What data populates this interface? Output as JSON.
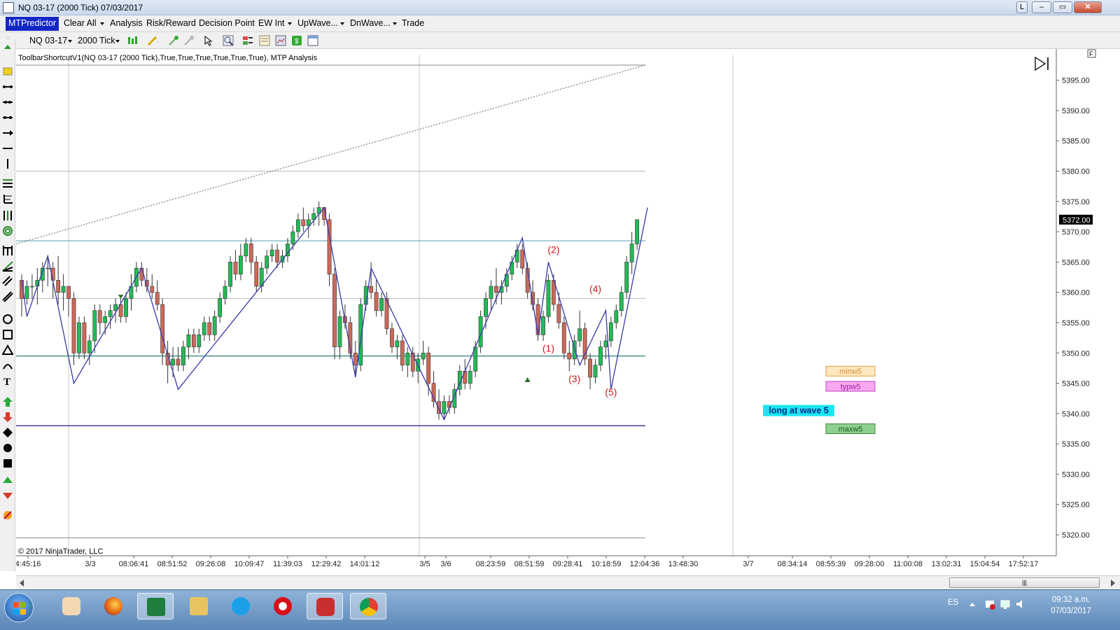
{
  "window": {
    "title": "NQ 03-17 (2000 Tick)  07/03/2017",
    "btn_l": "L",
    "btn_min": "–",
    "btn_max": "▭",
    "btn_close": "✕"
  },
  "menu": {
    "brand": "MTPredictor",
    "items": [
      "Clear All",
      "Analysis",
      "Risk/Reward",
      "Decision Point",
      "EW Int",
      "UpWave...",
      "DnWave...",
      "Trade"
    ]
  },
  "toolbar": {
    "instrument": "NQ 03-17",
    "period": "2000 Tick"
  },
  "chart_header": "ToolbarShortcutV1(NQ 03-17 (2000 Tick),True,True,True,True,True,True), MTP Analysis",
  "copyright": "© 2017 NinjaTrader, LLC",
  "chart_data": {
    "type": "candlestick",
    "instrument": "NQ 03-17",
    "period": "2000 Tick",
    "ylim": [
      5317,
      5399
    ],
    "yticks": [
      "5395.00",
      "5390.00",
      "5385.00",
      "5380.00",
      "5375.00",
      "5370.00",
      "5365.00",
      "5360.00",
      "5355.00",
      "5350.00",
      "5345.00",
      "5340.00",
      "5335.00",
      "5330.00",
      "5325.00",
      "5320.00"
    ],
    "last_price": "5372.00",
    "xtick_labels": [
      "4:45:16",
      "3/3",
      "08:06:41",
      "08:51:52",
      "09:26:08",
      "10:09:47",
      "11:39:03",
      "12:29:42",
      "14:01:12",
      "3/5",
      "3/6",
      "08:23:59",
      "08:51:59",
      "09:28:41",
      "10:18:59",
      "12:04:36",
      "13:48:30",
      "3/7",
      "08:34:14",
      "08:55:39",
      "09:28:00",
      "11:00:08",
      "13:02:31",
      "15:04:54",
      "17:52:17"
    ],
    "candles": [
      [
        5362,
        5363,
        5356,
        5359
      ],
      [
        5359,
        5362,
        5358,
        5361
      ],
      [
        5361,
        5363,
        5359,
        5361
      ],
      [
        5361,
        5364,
        5358,
        5362
      ],
      [
        5362,
        5365,
        5360,
        5364
      ],
      [
        5364,
        5366,
        5361,
        5364
      ],
      [
        5364,
        5365,
        5359,
        5362
      ],
      [
        5362,
        5366,
        5358,
        5360
      ],
      [
        5360,
        5363,
        5357,
        5361
      ],
      [
        5361,
        5361,
        5356,
        5359
      ],
      [
        5359,
        5360,
        5348,
        5350
      ],
      [
        5350,
        5356,
        5349,
        5355
      ],
      [
        5355,
        5356,
        5349,
        5350
      ],
      [
        5350,
        5353,
        5348,
        5352
      ],
      [
        5352,
        5358,
        5350,
        5357
      ],
      [
        5357,
        5358,
        5353,
        5355
      ],
      [
        5355,
        5357,
        5353,
        5356
      ],
      [
        5356,
        5358,
        5354,
        5357
      ],
      [
        5357,
        5359,
        5355,
        5358
      ],
      [
        5358,
        5359,
        5355,
        5356
      ],
      [
        5356,
        5360,
        5355,
        5359
      ],
      [
        5359,
        5363,
        5357,
        5361
      ],
      [
        5361,
        5365,
        5360,
        5364
      ],
      [
        5364,
        5365,
        5361,
        5362
      ],
      [
        5362,
        5364,
        5360,
        5361
      ],
      [
        5361,
        5363,
        5359,
        5360
      ],
      [
        5360,
        5362,
        5357,
        5358
      ],
      [
        5358,
        5359,
        5348,
        5350
      ],
      [
        5350,
        5352,
        5345,
        5348
      ],
      [
        5348,
        5351,
        5346,
        5349
      ],
      [
        5349,
        5351,
        5347,
        5348
      ],
      [
        5348,
        5352,
        5347,
        5351
      ],
      [
        5351,
        5354,
        5349,
        5353
      ],
      [
        5353,
        5354,
        5350,
        5351
      ],
      [
        5351,
        5354,
        5350,
        5353
      ],
      [
        5353,
        5356,
        5352,
        5355
      ],
      [
        5355,
        5356,
        5352,
        5353
      ],
      [
        5353,
        5357,
        5352,
        5356
      ],
      [
        5356,
        5360,
        5355,
        5359
      ],
      [
        5359,
        5362,
        5358,
        5361
      ],
      [
        5361,
        5366,
        5360,
        5365
      ],
      [
        5365,
        5367,
        5362,
        5363
      ],
      [
        5363,
        5368,
        5362,
        5366
      ],
      [
        5366,
        5369,
        5365,
        5368
      ],
      [
        5368,
        5369,
        5363,
        5365
      ],
      [
        5365,
        5366,
        5360,
        5361
      ],
      [
        5361,
        5365,
        5360,
        5364
      ],
      [
        5364,
        5367,
        5363,
        5366
      ],
      [
        5366,
        5368,
        5365,
        5367
      ],
      [
        5367,
        5368,
        5364,
        5365
      ],
      [
        5365,
        5367,
        5364,
        5366
      ],
      [
        5366,
        5369,
        5365,
        5368
      ],
      [
        5368,
        5371,
        5367,
        5370
      ],
      [
        5370,
        5373,
        5369,
        5372
      ],
      [
        5372,
        5374,
        5370,
        5371
      ],
      [
        5371,
        5373,
        5369,
        5372
      ],
      [
        5372,
        5374,
        5371,
        5373
      ],
      [
        5373,
        5375,
        5371,
        5374
      ],
      [
        5374,
        5374,
        5371,
        5372
      ],
      [
        5372,
        5373,
        5361,
        5363
      ],
      [
        5363,
        5364,
        5349,
        5351
      ],
      [
        5351,
        5357,
        5349,
        5356
      ],
      [
        5356,
        5358,
        5354,
        5355
      ],
      [
        5355,
        5356,
        5349,
        5350
      ],
      [
        5350,
        5352,
        5346,
        5348
      ],
      [
        5348,
        5359,
        5347,
        5358
      ],
      [
        5358,
        5362,
        5357,
        5361
      ],
      [
        5361,
        5365,
        5359,
        5360
      ],
      [
        5360,
        5362,
        5356,
        5357
      ],
      [
        5357,
        5360,
        5356,
        5359
      ],
      [
        5359,
        5360,
        5353,
        5354
      ],
      [
        5354,
        5355,
        5350,
        5351
      ],
      [
        5351,
        5353,
        5349,
        5352
      ],
      [
        5352,
        5353,
        5347,
        5348
      ],
      [
        5348,
        5351,
        5346,
        5350
      ],
      [
        5350,
        5351,
        5346,
        5347
      ],
      [
        5347,
        5350,
        5345,
        5349
      ],
      [
        5349,
        5352,
        5348,
        5350
      ],
      [
        5350,
        5351,
        5343,
        5345
      ],
      [
        5345,
        5347,
        5341,
        5342
      ],
      [
        5342,
        5344,
        5339,
        5340
      ],
      [
        5340,
        5343,
        5339,
        5342
      ],
      [
        5342,
        5343,
        5340,
        5341
      ],
      [
        5341,
        5345,
        5340,
        5344
      ],
      [
        5344,
        5348,
        5343,
        5347
      ],
      [
        5347,
        5349,
        5344,
        5345
      ],
      [
        5345,
        5348,
        5344,
        5347
      ],
      [
        5347,
        5352,
        5346,
        5351
      ],
      [
        5351,
        5357,
        5350,
        5356
      ],
      [
        5356,
        5360,
        5354,
        5359
      ],
      [
        5359,
        5362,
        5357,
        5361
      ],
      [
        5361,
        5364,
        5358,
        5360
      ],
      [
        5360,
        5362,
        5358,
        5361
      ],
      [
        5361,
        5364,
        5360,
        5363
      ],
      [
        5363,
        5366,
        5362,
        5365
      ],
      [
        5365,
        5368,
        5364,
        5367
      ],
      [
        5367,
        5368,
        5363,
        5364
      ],
      [
        5364,
        5365,
        5359,
        5360
      ],
      [
        5360,
        5362,
        5357,
        5358
      ],
      [
        5358,
        5359,
        5352,
        5353
      ],
      [
        5353,
        5357,
        5352,
        5356
      ],
      [
        5356,
        5363,
        5355,
        5362
      ],
      [
        5362,
        5363,
        5357,
        5358
      ],
      [
        5358,
        5360,
        5354,
        5355
      ],
      [
        5355,
        5356,
        5349,
        5350
      ],
      [
        5350,
        5352,
        5347,
        5349
      ],
      [
        5349,
        5353,
        5348,
        5352
      ],
      [
        5352,
        5357,
        5351,
        5354
      ],
      [
        5354,
        5355,
        5348,
        5349
      ],
      [
        5349,
        5350,
        5344,
        5346
      ],
      [
        5346,
        5349,
        5345,
        5348
      ],
      [
        5348,
        5352,
        5347,
        5351
      ],
      [
        5351,
        5353,
        5349,
        5352
      ],
      [
        5352,
        5356,
        5351,
        5355
      ],
      [
        5355,
        5358,
        5354,
        5357
      ],
      [
        5357,
        5361,
        5356,
        5360
      ],
      [
        5360,
        5366,
        5359,
        5365
      ],
      [
        5365,
        5370,
        5363,
        5368
      ],
      [
        5368,
        5372,
        5367,
        5372
      ]
    ],
    "zigzag_prices": [
      5362,
      5356,
      5366,
      5345,
      5364,
      5344,
      5374,
      5346,
      5364,
      5339,
      5369,
      5353,
      5365,
      5348,
      5357,
      5344,
      5374
    ],
    "zigzag_idx": [
      0,
      1,
      5,
      10,
      23,
      30,
      58,
      64,
      67,
      81,
      96,
      99,
      101,
      107,
      112,
      113,
      120
    ],
    "h_levels": [
      {
        "price": 5368.5,
        "color": "#7fb8c8"
      },
      {
        "price": 5349.5,
        "color": "#3a8a80"
      },
      {
        "price": 5338.0,
        "color": "#303090"
      },
      {
        "price": 5397.5,
        "color": "#888888"
      },
      {
        "price": 5380.0,
        "color": "#bbbbbb"
      },
      {
        "price": 5359.0,
        "color": "#bbbbbb"
      },
      {
        "price": 5319.5,
        "color": "#888888"
      }
    ],
    "wave_labels": [
      {
        "text": "(1)",
        "idx": 101,
        "price": 5350.2
      },
      {
        "text": "(2)",
        "idx": 102,
        "price": 5366.5
      },
      {
        "text": "(3)",
        "idx": 106,
        "price": 5345.2
      },
      {
        "text": "(4)",
        "idx": 110,
        "price": 5360.0
      },
      {
        "text": "(5)",
        "idx": 113,
        "price": 5343.0
      }
    ],
    "targets": [
      {
        "text": "minw5",
        "price": 5347.0,
        "fill": "#fde8c0",
        "stroke": "#e0a040",
        "color": "#d89030"
      },
      {
        "text": "typw5",
        "price": 5344.5,
        "fill": "#f7a8f0",
        "stroke": "#c040c0",
        "color": "#a020a0"
      },
      {
        "text": "maxw5",
        "price": 5337.5,
        "fill": "#8fd08f",
        "stroke": "#3a8a3a",
        "color": "#1a5a1a"
      }
    ],
    "note": {
      "text": "long at wave 5",
      "price": 5340.5,
      "fill": "#19e6f0",
      "color": "#0a2a8a"
    },
    "colors": {
      "up": "#22bb55",
      "down": "#cc6a5a",
      "zigzag": "#3a3aa8"
    }
  },
  "taskbar": {
    "lang": "ES",
    "time": "09:32 a.m.",
    "date": "07/03/2017"
  }
}
